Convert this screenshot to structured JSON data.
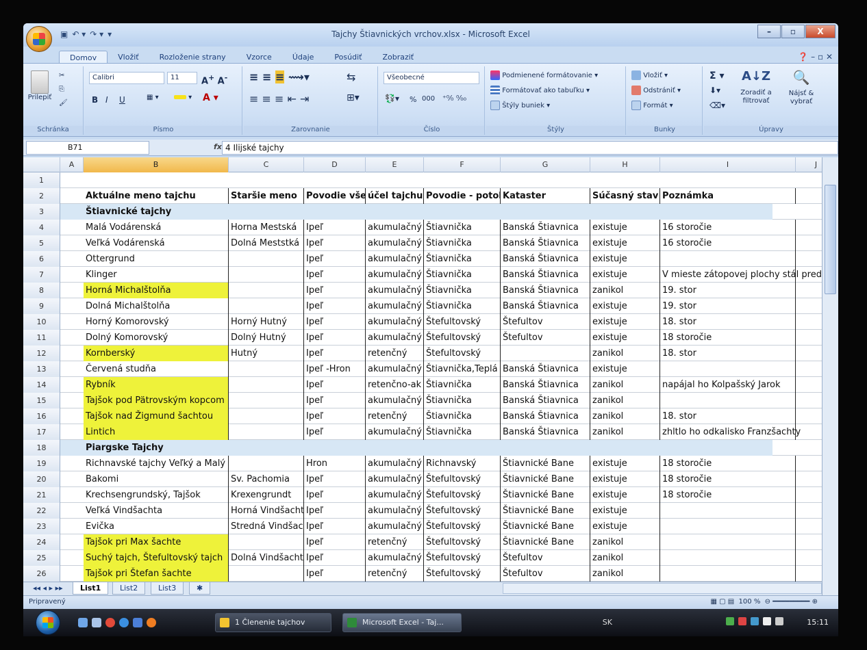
{
  "window": {
    "title": "Tajchy Štiavnických vrchov.xlsx - Microsoft Excel",
    "controls": [
      "–",
      "▫",
      "X"
    ]
  },
  "ribbon_tabs": [
    "Domov",
    "Vložiť",
    "Rozloženie strany",
    "Vzorce",
    "Údaje",
    "Posúdiť",
    "Zobraziť"
  ],
  "ribbon": {
    "clipboard": {
      "paste": "Prilepiť",
      "label": "Schránka"
    },
    "font": {
      "name": "Calibri",
      "size": "11",
      "label": "Písmo",
      "bold": "B",
      "italic": "I",
      "underline": "U"
    },
    "alignment": {
      "label": "Zarovnanie"
    },
    "number": {
      "format": "Všeobecné",
      "label": "Číslo",
      "percent": "%",
      "thousands": "000"
    },
    "styles": {
      "conditional": "Podmienené formátovanie",
      "as_table": "Formátovať ako tabuľku",
      "cell_styles": "Štýly buniek",
      "label": "Štýly"
    },
    "cells": {
      "insert": "Vložiť",
      "delete": "Odstrániť",
      "format": "Formát",
      "label": "Bunky"
    },
    "editing": {
      "sort": "Zoradiť a filtrovať",
      "find": "Nájsť & vybrať",
      "label": "Úpravy"
    }
  },
  "formula_bar": {
    "cell": "B71",
    "fx": "fx",
    "value": "4 Ilijské tajchy"
  },
  "columns": [
    "A",
    "B",
    "C",
    "D",
    "E",
    "F",
    "G",
    "H",
    "I",
    "J"
  ],
  "rows": [
    {
      "n": "1",
      "cells": [
        "",
        "",
        "",
        "",
        "",
        "",
        "",
        "",
        ""
      ]
    },
    {
      "n": "2",
      "type": "header",
      "cells": [
        "Aktuálne meno tajchu",
        "Staršie meno",
        "Povodie všeob",
        "účel tajchu",
        "Povodie - potok",
        "Kataster",
        "Súčasný stav",
        "Poznámka"
      ]
    },
    {
      "n": "3",
      "type": "section",
      "cells": [
        "Štiavnické tajchy"
      ]
    },
    {
      "n": "4",
      "cells": [
        "Malá Vodárenská",
        "Horna Mestská",
        "Ipeľ",
        "akumulačný",
        "Štiavnička",
        "Banská Štiavnica",
        "existuje",
        "16 storočie"
      ]
    },
    {
      "n": "5",
      "cells": [
        "Veľká Vodárenská",
        "Dolná Meststká",
        "Ipeľ",
        "akumulačný",
        "Štiavnička",
        "Banská Štiavnica",
        "existuje",
        "16 storočie"
      ]
    },
    {
      "n": "6",
      "cells": [
        "Ottergrund",
        "",
        "Ipeľ",
        "akumulačný",
        "Štiavnička",
        "Banská Štiavnica",
        "existuje",
        ""
      ]
    },
    {
      "n": "7",
      "cells": [
        "Klinger",
        "",
        "Ipeľ",
        "akumulačný",
        "Štiavnička",
        "Banská Štiavnica",
        "existuje",
        "V mieste zátopovej plochy stál pred v"
      ]
    },
    {
      "n": "8",
      "yellow": true,
      "cells": [
        "Horná Michalštolňa",
        "",
        "Ipeľ",
        "akumulačný",
        "Štiavnička",
        "Banská Štiavnica",
        "zanikol",
        "19. stor"
      ]
    },
    {
      "n": "9",
      "cells": [
        "Dolná Michalštolňa",
        "",
        "Ipeľ",
        "akumulačný",
        "Štiavnička",
        "Banská Štiavnica",
        "existuje",
        "19. stor"
      ]
    },
    {
      "n": "10",
      "cells": [
        "Horný Komorovský",
        "Horný Hutný",
        "Ipeľ",
        "akumulačný",
        "Štefultovský",
        "Štefultov",
        "existuje",
        "18. stor"
      ]
    },
    {
      "n": "11",
      "cells": [
        "Dolný Komorovský",
        "Dolný Hutný",
        "Ipeľ",
        "akumulačný",
        "Štefultovský",
        "Štefultov",
        "existuje",
        "18 storočie"
      ]
    },
    {
      "n": "12",
      "yellow": true,
      "cells": [
        "Kornberský",
        "Hutný",
        "Ipeľ",
        "retenčný",
        "Štefultovský",
        "",
        "zanikol",
        "18. stor"
      ]
    },
    {
      "n": "13",
      "cells": [
        "Červená studňa",
        "",
        "Ipeľ -Hron",
        "akumulačný",
        "Štiavnička,Teplá",
        "Banská Štiavnica",
        "existuje",
        ""
      ]
    },
    {
      "n": "14",
      "yellow": true,
      "cells": [
        "Rybník",
        "",
        "Ipeľ",
        "retenčno-ak",
        "Štiavnička",
        "Banská Štiavnica",
        "zanikol",
        "napájal ho Kolpašský Jarok"
      ]
    },
    {
      "n": "15",
      "yellow": true,
      "cells": [
        "Tajšok pod Pätrovským kopcom",
        "",
        "Ipeľ",
        "akumulačný",
        "Štiavnička",
        "Banská Štiavnica",
        "zanikol",
        ""
      ]
    },
    {
      "n": "16",
      "yellow": true,
      "cells": [
        "Tajšok nad Žigmund šachtou",
        "",
        "Ipeľ",
        "retenčný",
        "Štiavnička",
        "Banská Štiavnica",
        "zanikol",
        "18. stor"
      ]
    },
    {
      "n": "17",
      "yellow": true,
      "cells": [
        "Lintich",
        "",
        "Ipeľ",
        "akumulačný",
        "Štiavnička",
        "Banská Štiavnica",
        "zanikol",
        "zhltlo ho odkalisko Franzšachty"
      ]
    },
    {
      "n": "18",
      "type": "section",
      "cells": [
        "Piargske Tajchy"
      ]
    },
    {
      "n": "19",
      "cells": [
        "Richnavské tajchy Veľký a Malý",
        "",
        "Hron",
        "akumulačný",
        "Richnavský",
        "Štiavnické Bane",
        "existuje",
        "18 storočie"
      ]
    },
    {
      "n": "20",
      "cells": [
        "Bakomi",
        "Sv. Pachomia",
        "Ipeľ",
        "akumulačný",
        "Štefultovský",
        "Štiavnické Bane",
        "existuje",
        "18 storočie"
      ]
    },
    {
      "n": "21",
      "cells": [
        "Krechsengrundský, Tajšok",
        "Krexengrundt",
        "Ipeľ",
        "akumulačný",
        "Štefultovský",
        "Štiavnické Bane",
        "existuje",
        "18 storočie"
      ]
    },
    {
      "n": "22",
      "cells": [
        "Veľká Vindšachta",
        "Horná Vindšacht",
        "Ipeľ",
        "akumulačný",
        "Štefultovský",
        "Štiavnické Bane",
        "existuje",
        ""
      ]
    },
    {
      "n": "23",
      "cells": [
        "Evička",
        "Stredná Vindšac",
        "Ipeľ",
        "akumulačný",
        "Štefultovský",
        "Štiavnické Bane",
        "existuje",
        ""
      ]
    },
    {
      "n": "24",
      "yellow": true,
      "cells": [
        "Tajšok pri Max šachte",
        "",
        "Ipeľ",
        "retenčný",
        "Štefultovský",
        "Štiavnické Bane",
        "zanikol",
        ""
      ]
    },
    {
      "n": "25",
      "yellow": true,
      "cells": [
        "Suchý tajch, Štefultovský tajch",
        "Dolná Vindšacht",
        "Ipeľ",
        "akumulačný",
        "Štefultovský",
        "Štefultov",
        "zanikol",
        ""
      ]
    },
    {
      "n": "26",
      "yellow": true,
      "cells": [
        "Tajšok pri Štefan šachte",
        "",
        "Ipeľ",
        "retenčný",
        "Štefultovský",
        "Štefultov",
        "zanikol",
        ""
      ]
    }
  ],
  "sheets": [
    "List1",
    "List2",
    "List3"
  ],
  "status": {
    "text": "Pripravený",
    "zoom": "100 %"
  },
  "taskbar": {
    "tasks": [
      "1 Členenie tajchov",
      "Microsoft Excel - Taj..."
    ],
    "lang": "SK",
    "clock": "15:11"
  },
  "colors": {
    "yellow_fill": "#eef23a",
    "section_fill": "#d7e7f5",
    "selected_col": "#f1b84b"
  }
}
